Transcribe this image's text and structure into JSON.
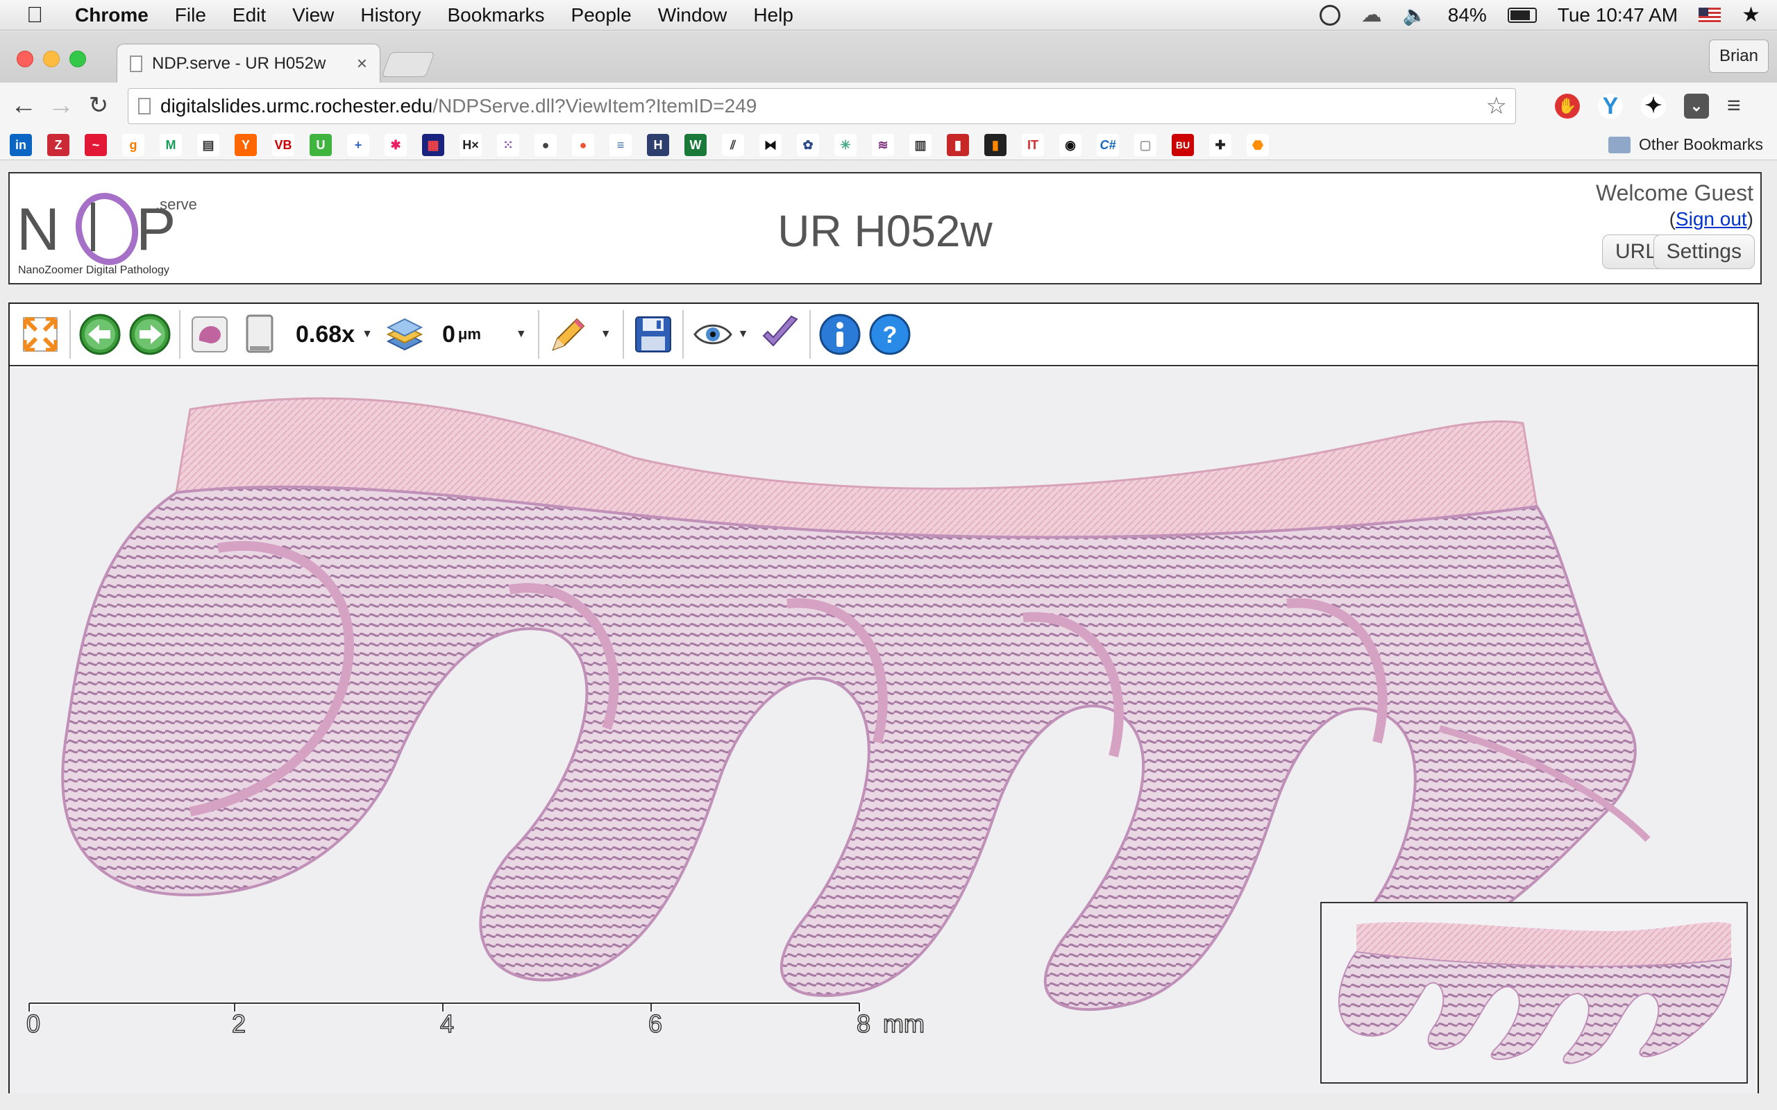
{
  "menubar": {
    "app": "Chrome",
    "items": [
      "File",
      "Edit",
      "View",
      "History",
      "Bookmarks",
      "People",
      "Window",
      "Help"
    ],
    "battery": "84%",
    "clock": "Tue 10:47 AM"
  },
  "tab": {
    "title": "NDP.serve - UR H052w",
    "close": "×"
  },
  "profile": "Brian",
  "omnibox": {
    "host": "digitalslides.urmc.rochester.edu",
    "path": "/NDPServe.dll?ViewItem?ItemID=249"
  },
  "bookmarks": {
    "items": [
      "in",
      "Z",
      "~",
      "g",
      "M",
      "▤",
      "Y",
      "VB",
      "U",
      "+",
      "✱",
      "▦",
      "H×",
      "⁙",
      "●",
      "●",
      "≡",
      "H",
      "W",
      "⫽",
      "⧓",
      "✿",
      "✳",
      "≋",
      "▥",
      "▮",
      "▮",
      "IT",
      "◉",
      "C#",
      "▢",
      "BU",
      "✚",
      "⬣"
    ],
    "other": "Other Bookmarks"
  },
  "header": {
    "logo_suffix": ".serve",
    "logo_tagline": "NanoZoomer Digital Pathology",
    "title": "UR H052w",
    "welcome": "Welcome Guest",
    "signout": "Sign out",
    "url_button": "URL",
    "settings_button": "Settings"
  },
  "viewer": {
    "zoom": "0.68x",
    "focus_value": "0",
    "focus_unit": "μm",
    "scale_ticks": [
      "0",
      "2",
      "4",
      "6",
      "8"
    ],
    "scale_unit": "mm"
  }
}
